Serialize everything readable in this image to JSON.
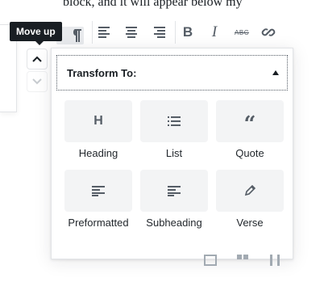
{
  "editor": {
    "text_line": "block, and it will appear below my"
  },
  "block_mover": {
    "tooltip": "Move up",
    "up_icon": "chevron-up-icon",
    "down_icon": "chevron-down-icon"
  },
  "toolbar": {
    "icons": [
      "paragraph-icon",
      "align-left-icon",
      "align-center-icon",
      "align-right-icon",
      "bold-icon",
      "italic-icon",
      "strikethrough-icon",
      "link-icon"
    ],
    "italic_glyph": "I",
    "bold_glyph": "B",
    "strike_glyph": "ABC"
  },
  "transform": {
    "title": "Transform To:",
    "items": [
      {
        "label": "Heading",
        "icon": "heading-icon",
        "glyph": "H"
      },
      {
        "label": "List",
        "icon": "list-icon"
      },
      {
        "label": "Quote",
        "icon": "quote-icon",
        "glyph": "“"
      },
      {
        "label": "Preformatted",
        "icon": "preformatted-icon"
      },
      {
        "label": "Subheading",
        "icon": "subheading-icon"
      },
      {
        "label": "Verse",
        "icon": "pencil-icon"
      }
    ]
  },
  "colors": {
    "text": "#191e23",
    "tooltip_bg": "#191e23",
    "tile_bg": "#f3f4f5",
    "border": "#e2e4e7"
  }
}
